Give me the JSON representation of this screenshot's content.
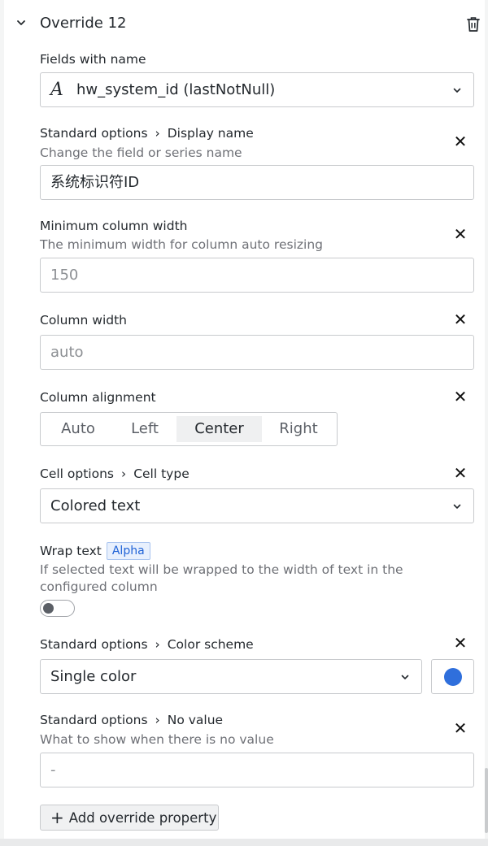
{
  "override": {
    "title": "Override 12"
  },
  "matcher": {
    "label": "Fields with name",
    "value": "hw_system_id (lastNotNull)",
    "icon": "string-field-icon"
  },
  "display_name": {
    "crumb1": "Standard options",
    "crumb2": "Display name",
    "description": "Change the field or series name",
    "value": "系统标识符ID"
  },
  "min_width": {
    "label": "Minimum column width",
    "description": "The minimum width for column auto resizing",
    "placeholder": "150"
  },
  "col_width": {
    "label": "Column width",
    "placeholder": "auto"
  },
  "alignment": {
    "label": "Column alignment",
    "options": [
      "Auto",
      "Left",
      "Center",
      "Right"
    ],
    "selected": "Center"
  },
  "cell_type": {
    "crumb1": "Cell options",
    "crumb2": "Cell type",
    "value": "Colored text"
  },
  "wrap_text": {
    "label": "Wrap text",
    "badge": "Alpha",
    "description_line1": "If selected text will be wrapped to the width of text in the",
    "description_line2": "configured column",
    "enabled": false
  },
  "color_scheme": {
    "crumb1": "Standard options",
    "crumb2": "Color scheme",
    "value": "Single color",
    "color": "#2f6fdc"
  },
  "no_value": {
    "crumb1": "Standard options",
    "crumb2": "No value",
    "description": "What to show when there is no value",
    "placeholder": "-"
  },
  "add_property": {
    "label": "Add override property"
  }
}
